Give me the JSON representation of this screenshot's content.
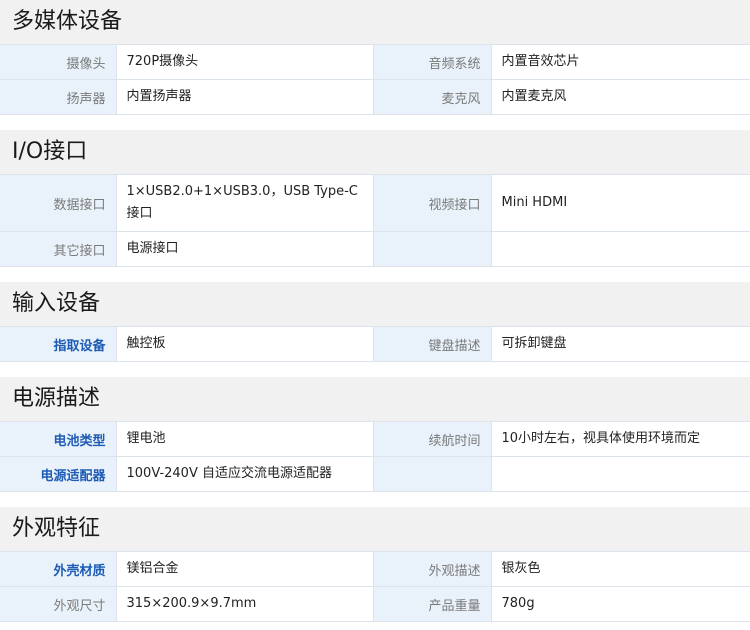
{
  "sections": [
    {
      "title": "多媒体设备",
      "rows": [
        {
          "k1": "摄像头",
          "v1": "720P摄像头",
          "k2": "音频系统",
          "v2": "内置音效芯片"
        },
        {
          "k1": "扬声器",
          "v1": "内置扬声器",
          "k2": "麦克风",
          "v2": "内置麦克风"
        }
      ]
    },
    {
      "title": "I/O接口",
      "rows": [
        {
          "k1": "数据接口",
          "v1": "1×USB2.0+1×USB3.0，USB Type-C接口",
          "k2": "视频接口",
          "v2": "Mini HDMI"
        },
        {
          "k1": "其它接口",
          "v1": "电源接口",
          "k2": "",
          "v2": ""
        }
      ]
    },
    {
      "title": "输入设备",
      "rows": [
        {
          "k1": "指取设备",
          "v1": "触控板",
          "k2": "键盘描述",
          "v2": "可拆卸键盘"
        }
      ]
    },
    {
      "title": "电源描述",
      "rows": [
        {
          "k1": "电池类型",
          "v1": "锂电池",
          "k2": "续航时间",
          "v2": "10小时左右，视具体使用环境而定"
        },
        {
          "k1": "电源适配器",
          "v1": "100V-240V 自适应交流电源适配器",
          "k2": "",
          "v2": ""
        }
      ]
    },
    {
      "title": "外观特征",
      "rows": [
        {
          "k1": "外壳材质",
          "v1": "镁铝合金",
          "k2": "外观描述",
          "v2": "银灰色"
        },
        {
          "k1": "外观尺寸",
          "v1": "315×200.9×9.7mm",
          "k2": "产品重量",
          "v2": "780g"
        }
      ]
    }
  ]
}
